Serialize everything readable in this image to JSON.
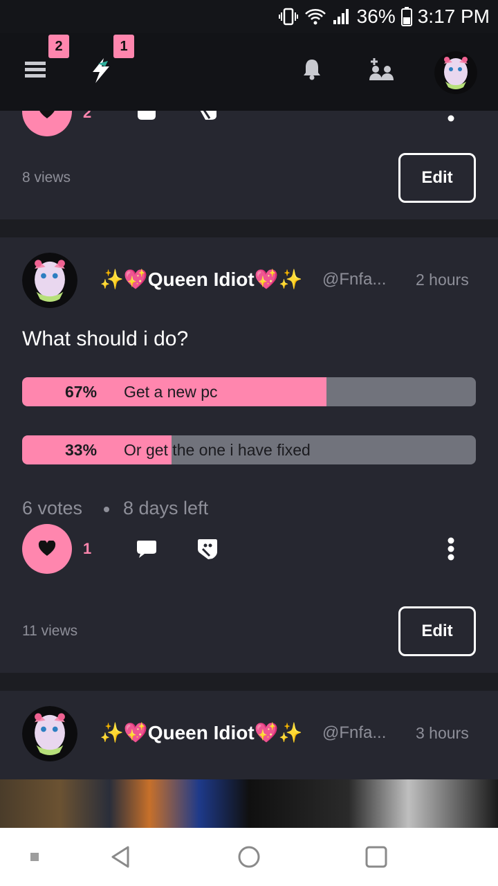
{
  "status_bar": {
    "battery": "36%",
    "time": "3:17 PM"
  },
  "header": {
    "menu_badge": "2",
    "lightning_badge": "1"
  },
  "post_prev": {
    "like_count": "2",
    "views": "8 views",
    "edit_label": "Edit"
  },
  "post_poll": {
    "author": "✨💖Queen Idiot💖✨",
    "handle": "@Fnfa...",
    "time": "2 hours",
    "question": "What should i do?",
    "options": [
      {
        "percent": "67%",
        "label": "Get a new pc",
        "fraction": 0.67
      },
      {
        "percent": "33%",
        "label": "Or get the one i have fixed",
        "fraction": 0.33
      }
    ],
    "votes": "6 votes",
    "days_left": "8 days left",
    "like_count": "1",
    "views": "11 views",
    "edit_label": "Edit"
  },
  "post_next": {
    "author": "✨💖Queen Idiot💖✨",
    "handle": "@Fnfa...",
    "time": "3 hours"
  },
  "colors": {
    "accent": "#ff86ae",
    "card": "#262730",
    "bg": "#1c1d22"
  }
}
